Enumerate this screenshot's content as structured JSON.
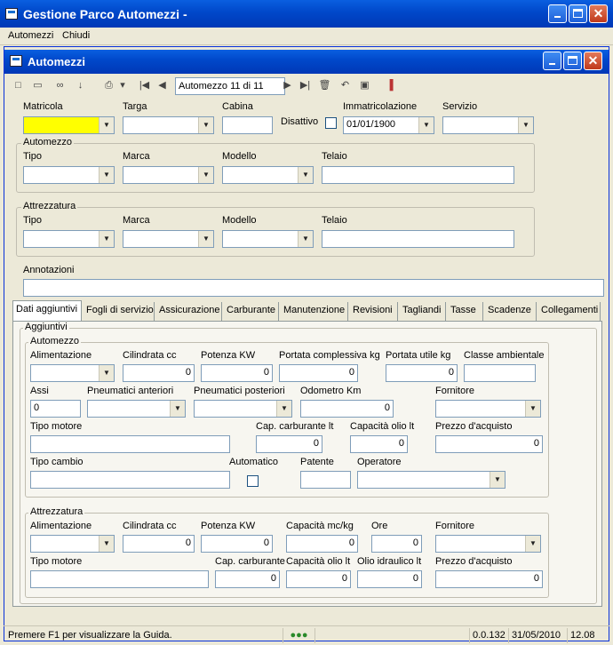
{
  "window": {
    "title": "Gestione Parco Automezzi",
    "suffix": "-"
  },
  "menu": {
    "items": [
      "Automezzi",
      "Chiudi"
    ]
  },
  "child": {
    "title": "Automezzi"
  },
  "toolbar": {
    "record_label": "Automezzo 11 di 11"
  },
  "top": {
    "matricola": "Matricola",
    "targa": "Targa",
    "cabina": "Cabina",
    "disattivo": "Disattivo",
    "immatricolazione": "Immatricolazione",
    "immatricolazione_value": "01/01/1900",
    "servizio": "Servizio"
  },
  "automezzo_group": {
    "title": "Automezzo",
    "tipo": "Tipo",
    "marca": "Marca",
    "modello": "Modello",
    "telaio": "Telaio"
  },
  "attrezzatura_group": {
    "title": "Attrezzatura",
    "tipo": "Tipo",
    "marca": "Marca",
    "modello": "Modello",
    "telaio": "Telaio"
  },
  "annotazioni": "Annotazioni",
  "tabs": [
    "Dati aggiuntivi",
    "Fogli di servizio",
    "Assicurazione",
    "Carburante",
    "Manutenzione",
    "Revisioni",
    "Tagliandi",
    "Tasse",
    "Scadenze",
    "Collegamenti"
  ],
  "panel": {
    "aggiuntivi": "Aggiuntivi",
    "auto": {
      "title": "Automezzo",
      "alimentazione": "Alimentazione",
      "cilindrata": "Cilindrata cc",
      "cilindrata_value": "0",
      "potenza": "Potenza KW",
      "potenza_value": "0",
      "portata_complessiva": "Portata complessiva kg",
      "portata_complessiva_value": "0",
      "portata_utile": "Portata utile kg",
      "portata_utile_value": "0",
      "classe": "Classe ambientale",
      "assi": "Assi",
      "assi_value": "0",
      "pneu_ant": "Pneumatici anteriori",
      "pneu_post": "Pneumatici posteriori",
      "odometro": "Odometro Km",
      "odometro_value": "0",
      "fornitore": "Fornitore",
      "tipo_motore": "Tipo motore",
      "cap_carb": "Cap. carburante lt",
      "cap_carb_value": "0",
      "cap_olio": "Capacità olio lt",
      "cap_olio_value": "0",
      "prezzo": "Prezzo d'acquisto",
      "prezzo_value": "0",
      "tipo_cambio": "Tipo cambio",
      "automatico": "Automatico",
      "patente": "Patente",
      "operatore": "Operatore"
    },
    "attr": {
      "title": "Attrezzatura",
      "alimentazione": "Alimentazione",
      "cilindrata": "Cilindrata cc",
      "cilindrata_value": "0",
      "potenza": "Potenza KW",
      "potenza_value": "0",
      "capacita": "Capacità mc/kg",
      "capacita_value": "0",
      "ore": "Ore",
      "ore_value": "0",
      "fornitore": "Fornitore",
      "tipo_motore": "Tipo motore",
      "cap_carb": "Cap. carburante",
      "cap_carb_value": "0",
      "cap_olio": "Capacità olio lt",
      "cap_olio_value": "0",
      "olio_idr": "Olio idraulico lt",
      "olio_idr_value": "0",
      "prezzo": "Prezzo d'acquisto",
      "prezzo_value": "0"
    }
  },
  "status": {
    "help": "Premere F1 per visualizzare la Guida.",
    "version": "0.0.132",
    "date": "31/05/2010",
    "time": "12.08"
  }
}
